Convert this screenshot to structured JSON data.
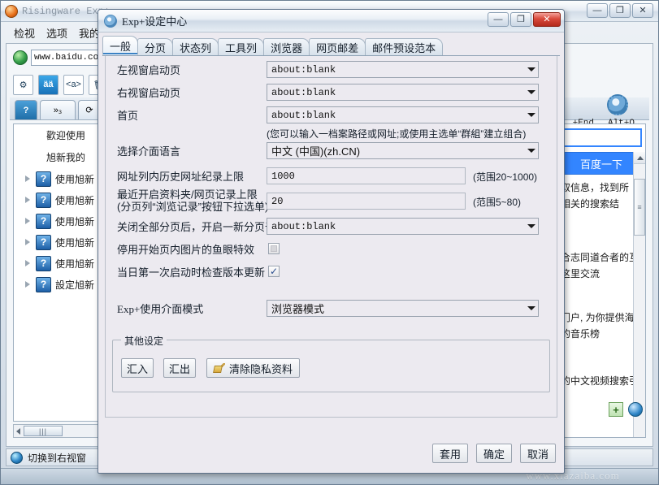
{
  "background_window": {
    "title": "Risingware Exp+",
    "icon": "app-globe-icon",
    "menus": [
      "检视",
      "选项",
      "我的书"
    ],
    "window_buttons": {
      "minimize": "—",
      "maximize": "❐",
      "close": "✕"
    },
    "address_bar": {
      "value": "www.baidu.co",
      "icon": "globe-icon"
    },
    "toolbar_icons": [
      "settings-icon",
      "font-icon",
      "source-icon",
      "trash-icon"
    ],
    "tabs": [
      "help-tab",
      "more-tab",
      "refresh-tab",
      "stop-tab"
    ],
    "tree": {
      "header_lines": [
        "歡迎使用",
        "旭新我的"
      ],
      "items": [
        {
          "label": "使用旭新",
          "icon": "question-icon"
        },
        {
          "label": "使用旭新",
          "icon": "question-icon"
        },
        {
          "label": "使用旭新",
          "icon": "question-icon"
        },
        {
          "label": "使用旭新",
          "icon": "question-icon"
        },
        {
          "label": "使用旭新",
          "icon": "question-icon"
        },
        {
          "label": "設定旭新",
          "icon": "question-icon"
        }
      ],
      "hscroll_thumb": "|||"
    },
    "web_pane": {
      "search_button": "百度一下",
      "lines": [
        "取信息，找到所",
        "相关的搜索结",
        "",
        "合志同道合者的互",
        "这里交流",
        "",
        "门户, 为你提供海",
        "的音乐榜",
        "",
        "的中文视频搜索引"
      ],
      "ellipsis": "..."
    },
    "shortcut_hints": {
      "end": "+End",
      "alt_o": "Alt+O"
    },
    "statusbar": {
      "text": "切换到右视窗",
      "icon": "globe-icon"
    },
    "watermark": "www.xiazaiba.com"
  },
  "dialog": {
    "title": "Exp+设定中心",
    "icon": "gear-icon",
    "window_buttons": {
      "minimize": "—",
      "maximize": "❐",
      "close": "✕"
    },
    "tabs": [
      {
        "label": "一般",
        "active": true
      },
      {
        "label": "分页",
        "active": false
      },
      {
        "label": "状态列",
        "active": false
      },
      {
        "label": "工具列",
        "active": false
      },
      {
        "label": "浏览器",
        "active": false
      },
      {
        "label": "网页邮差",
        "active": false
      },
      {
        "label": "邮件预设范本",
        "active": false
      }
    ],
    "fields": {
      "left_startpage": {
        "label": "左视窗启动页",
        "value": "about:blank"
      },
      "right_startpage": {
        "label": "右视窗启动页",
        "value": "about:blank"
      },
      "homepage": {
        "label": "首页",
        "value": "about:blank"
      },
      "homepage_note": "(您可以输入一档案路径或网址;或使用主选单“群組”建立组合)",
      "ui_language": {
        "label": "选择介面语言",
        "value": "中文 (中国)(zh.CN)"
      },
      "url_history_limit": {
        "label": "网址列内历史网址纪录上限",
        "value": "1000",
        "hint": "(范围20~1000)"
      },
      "recent_limit": {
        "label": "最近开启资料夹/网页记录上限\n (分页列“浏览记录”按钮下拉选单)",
        "value": "20",
        "hint": "(范围5~80)"
      },
      "close_all_tabs": {
        "label": "关闭全部分页后，开启一新分页于",
        "value": "about:blank"
      },
      "disable_fisheye": {
        "label": "停用开始页内图片的鱼眼特效",
        "checked": false
      },
      "check_update": {
        "label": "当日第一次启动时检查版本更新",
        "checked": true
      },
      "ui_mode": {
        "label": "Exp+使用介面模式",
        "value": "浏览器模式"
      }
    },
    "group": {
      "legend": "其他设定",
      "import_label": "汇入",
      "export_label": "汇出",
      "clear_privacy_label": "清除隐私资料",
      "clear_privacy_icon": "broom-icon"
    },
    "footer": {
      "apply": "套用",
      "ok": "确定",
      "cancel": "取消"
    }
  }
}
